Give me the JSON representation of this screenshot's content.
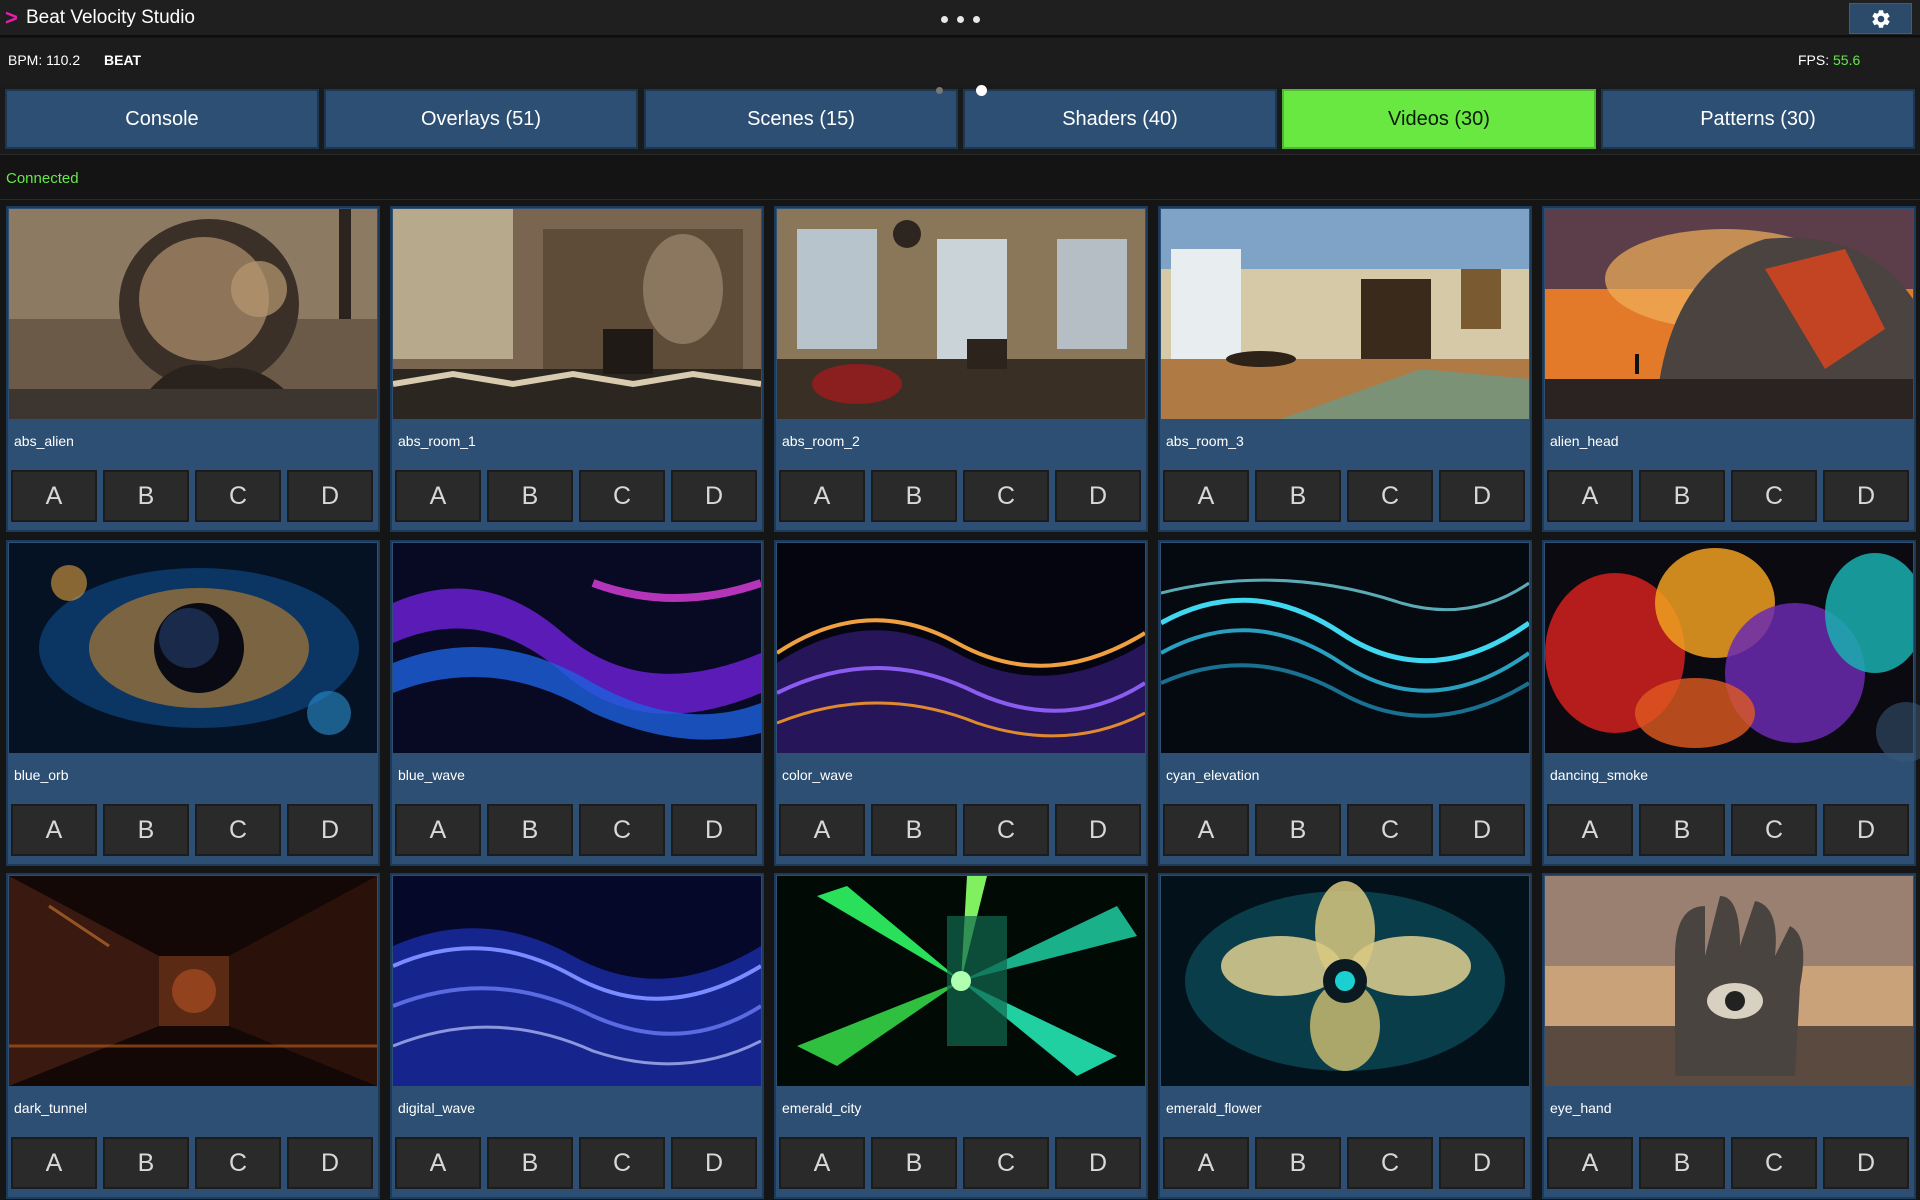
{
  "app": {
    "logo_glyph": ">",
    "title": "Beat Velocity Studio",
    "menu_icon": "more-dots-icon",
    "settings_icon": "gear-icon"
  },
  "status": {
    "bpm": "BPM: 110.2",
    "beat": "BEAT",
    "fps_label": "FPS: ",
    "fps_value": "55.6"
  },
  "tabs": [
    {
      "label": "Console",
      "active": false
    },
    {
      "label": "Overlays (51)",
      "active": false
    },
    {
      "label": "Scenes (15)",
      "active": false
    },
    {
      "label": "Shaders (40)",
      "active": false
    },
    {
      "label": "Videos (30)",
      "active": true
    },
    {
      "label": "Patterns (30)",
      "active": false
    }
  ],
  "pager": {
    "pages": 2,
    "current": 2
  },
  "connection": {
    "status": "Connected"
  },
  "colors": {
    "accent_green": "#6ae842",
    "panel_blue": "#2c4f73",
    "logo_magenta": "#e61fb0",
    "status_green": "#66e84a"
  },
  "slot_labels": [
    "A",
    "B",
    "C",
    "D"
  ],
  "videos": [
    {
      "name": "abs_alien"
    },
    {
      "name": "abs_room_1"
    },
    {
      "name": "abs_room_2"
    },
    {
      "name": "abs_room_3"
    },
    {
      "name": "alien_head"
    },
    {
      "name": "blue_orb"
    },
    {
      "name": "blue_wave"
    },
    {
      "name": "color_wave"
    },
    {
      "name": "cyan_elevation"
    },
    {
      "name": "dancing_smoke"
    },
    {
      "name": "dark_tunnel"
    },
    {
      "name": "digital_wave"
    },
    {
      "name": "emerald_city"
    },
    {
      "name": "emerald_flower"
    },
    {
      "name": "eye_hand"
    }
  ]
}
